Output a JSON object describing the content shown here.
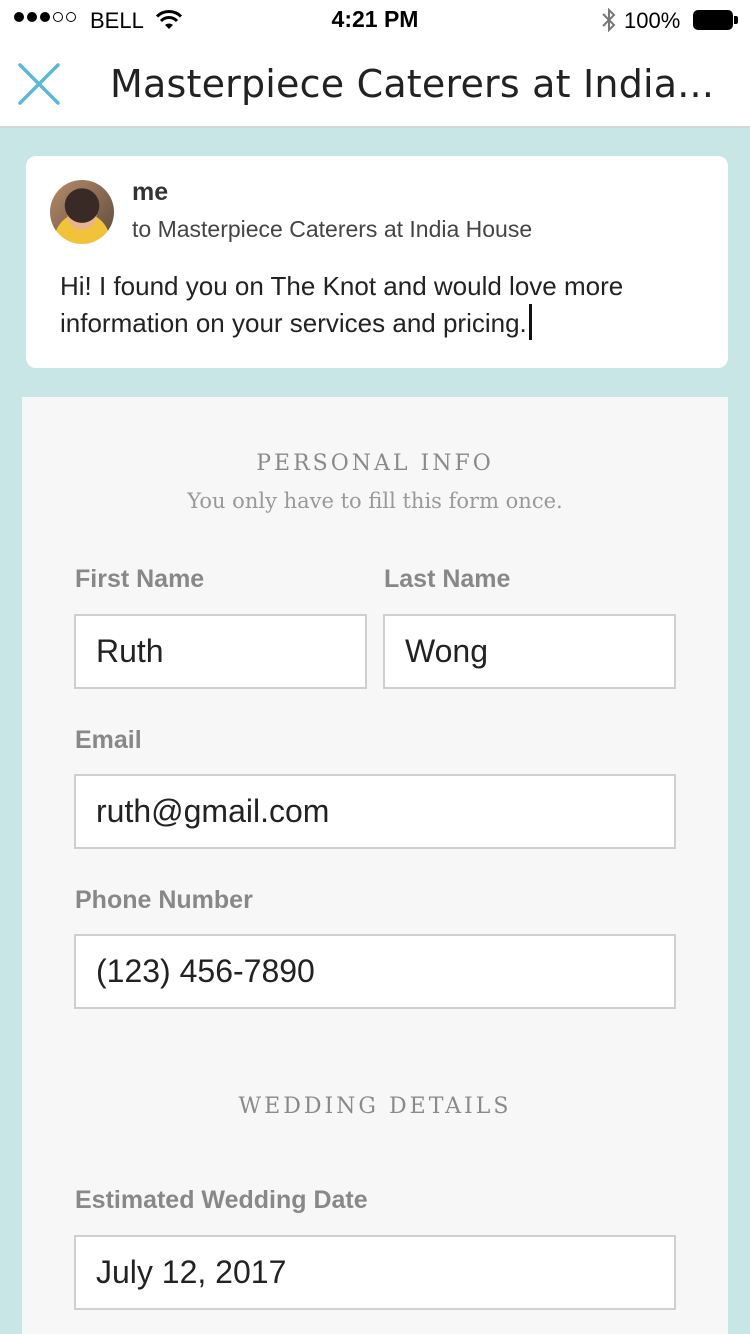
{
  "status_bar": {
    "carrier": "BELL",
    "time": "4:21 PM",
    "battery": "100%",
    "signal_bars_filled": 3,
    "signal_bars_total": 5
  },
  "nav": {
    "title": "Masterpiece Caterers at India...",
    "close_icon": "close-icon"
  },
  "message": {
    "sender": "me",
    "recipient": "to Masterpiece Caterers at India House",
    "body": "Hi! I found you on The Knot and would love more information on your services and pricing."
  },
  "personal_info": {
    "heading": "PERSONAL INFO",
    "subheading": "You only have to fill this form once.",
    "first_name_label": "First Name",
    "first_name_value": "Ruth",
    "last_name_label": "Last Name",
    "last_name_value": "Wong",
    "email_label": "Email",
    "email_value": "ruth@gmail.com",
    "phone_label": "Phone Number",
    "phone_value": "(123) 456-7890"
  },
  "wedding_details": {
    "heading": "WEDDING DETAILS",
    "date_label": "Estimated Wedding Date",
    "date_value": "July 12, 2017"
  },
  "colors": {
    "accent": "#5ab8d8",
    "background": "#c8e6e5",
    "panel": "#f7f7f7"
  }
}
